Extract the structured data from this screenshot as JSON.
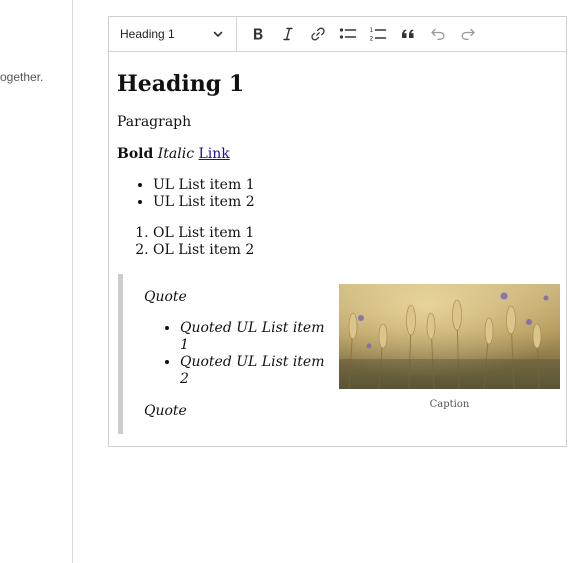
{
  "left_panel": {
    "truncated_text": "ogether."
  },
  "toolbar": {
    "heading_select_value": "Heading 1",
    "buttons": [
      {
        "name": "bold-button",
        "icon": "bold-icon"
      },
      {
        "name": "italic-button",
        "icon": "italic-icon"
      },
      {
        "name": "link-button",
        "icon": "link-icon"
      },
      {
        "name": "bulleted-list-button",
        "icon": "bulleted-list-icon"
      },
      {
        "name": "numbered-list-button",
        "icon": "numbered-list-icon"
      },
      {
        "name": "block-quote-button",
        "icon": "quote-icon"
      },
      {
        "name": "undo-button",
        "icon": "undo-icon"
      },
      {
        "name": "redo-button",
        "icon": "redo-icon"
      }
    ]
  },
  "content": {
    "heading": "Heading 1",
    "paragraph": "Paragraph",
    "bold": "Bold",
    "italic": "Italic",
    "link": "Link",
    "ul_items": [
      "UL List item 1",
      "UL List item 2"
    ],
    "ol_items": [
      "OL List item 1",
      "OL List item 2"
    ],
    "quote": {
      "paragraph_1": "Quote",
      "ul_items": [
        "Quoted UL List item 1",
        "Quoted UL List item 2"
      ],
      "paragraph_2": "Quote"
    },
    "figure": {
      "image": "wheat-field-photo",
      "caption": "Caption"
    }
  },
  "colors": {
    "link": "#1a0dab",
    "border": "#cfcfcf",
    "quote_bar": "#cccccc"
  }
}
